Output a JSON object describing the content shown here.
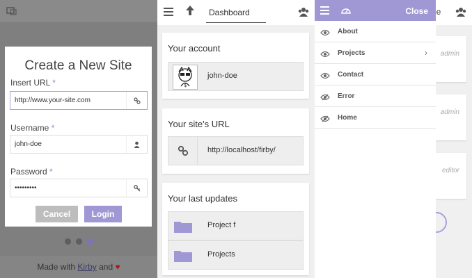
{
  "panel_create": {
    "title": "Create a New Site",
    "url": {
      "label": "Insert URL",
      "required_mark": "*",
      "value": "http://www.your-site.com",
      "icon": "link-icon"
    },
    "username": {
      "label": "Username",
      "required_mark": "*",
      "value": "john-doe",
      "icon": "user-icon"
    },
    "password": {
      "label": "Password",
      "required_mark": "*",
      "value": "•••••••••",
      "icon": "key-icon"
    },
    "cancel_label": "Cancel",
    "login_label": "Login",
    "footer": {
      "prefix": "Made with",
      "link": "Kirby",
      "suffix": "and",
      "heart": "♥"
    }
  },
  "panel_dashboard": {
    "title": "Dashboard",
    "account": {
      "heading": "Your account",
      "username": "john-doe"
    },
    "site_url": {
      "heading": "Your site's URL",
      "url": "http://localhost/firby/"
    },
    "updates": {
      "heading": "Your last updates",
      "items": [
        {
          "label": "Project f"
        },
        {
          "label": "Projects"
        }
      ]
    }
  },
  "panel_menu": {
    "close_label": "Close",
    "bg_title_fragment": "de",
    "items": [
      {
        "label": "About",
        "icon": "eye-icon"
      },
      {
        "label": "Projects",
        "icon": "eye-icon",
        "has_children": true
      },
      {
        "label": "Contact",
        "icon": "eye-icon"
      },
      {
        "label": "Error",
        "icon": "eye-slash-icon"
      },
      {
        "label": "Home",
        "icon": "eye-slash-icon"
      }
    ],
    "background_roles": [
      "admin",
      "admin",
      "editor"
    ]
  },
  "colors": {
    "accent": "#9f98d4",
    "overlay": "#7f7f7f",
    "heart": "#a41c1c"
  }
}
